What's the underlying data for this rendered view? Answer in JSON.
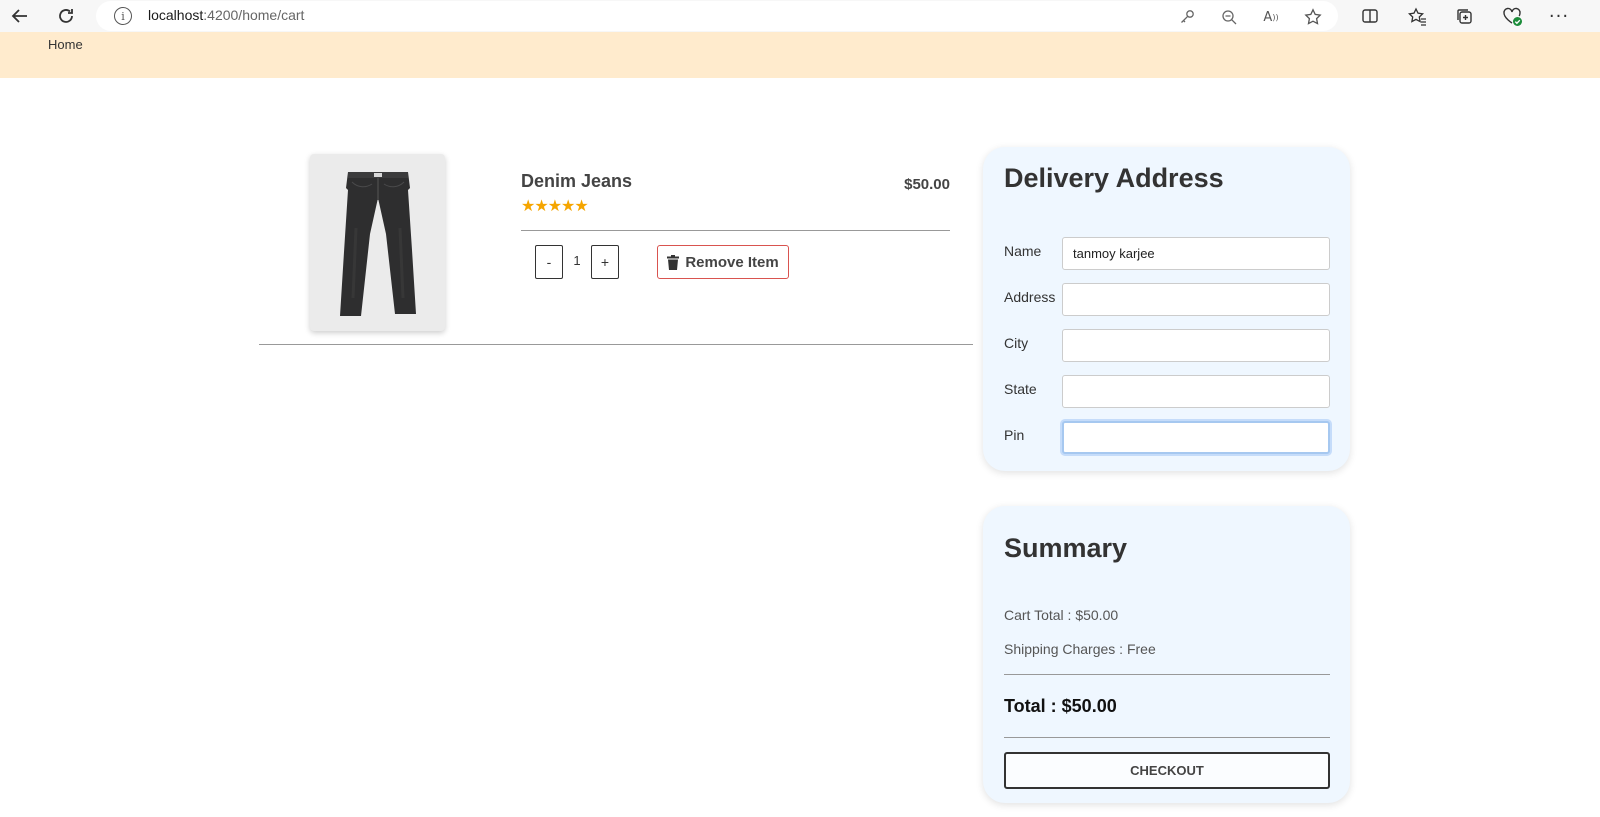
{
  "browser": {
    "url_host": "localhost",
    "url_path": ":4200/home/cart",
    "icons": [
      "back-icon",
      "refresh-icon",
      "info-icon",
      "key-icon",
      "zoom-out-icon",
      "read-aloud-icon",
      "favorite-star-icon",
      "split-screen-icon",
      "favorites-icon",
      "collections-icon",
      "browser-essentials-icon",
      "more-icon"
    ]
  },
  "header": {
    "home_label": "Home",
    "background": "#ffebcd"
  },
  "cart": {
    "item": {
      "name": "Denim Jeans",
      "rating_stars": "★★★★★",
      "rating": 5,
      "price": "$50.00",
      "quantity": "1",
      "decrement_label": "-",
      "increment_label": "+",
      "remove_label": "Remove Item"
    }
  },
  "delivery": {
    "title": "Delivery Address",
    "fields": {
      "name": {
        "label": "Name",
        "value": "tanmoy karjee"
      },
      "address": {
        "label": "Address",
        "value": ""
      },
      "city": {
        "label": "City",
        "value": ""
      },
      "state": {
        "label": "State",
        "value": ""
      },
      "pin": {
        "label": "Pin",
        "value": ""
      }
    }
  },
  "summary": {
    "title": "Summary",
    "cart_total": "Cart Total : $50.00",
    "shipping": "Shipping Charges : Free",
    "total": "Total : $50.00",
    "checkout_label": "CHECKOUT"
  },
  "colors": {
    "card_bg": "#eff7ff",
    "star": "#f5a500",
    "remove_border": "#d9534f"
  }
}
